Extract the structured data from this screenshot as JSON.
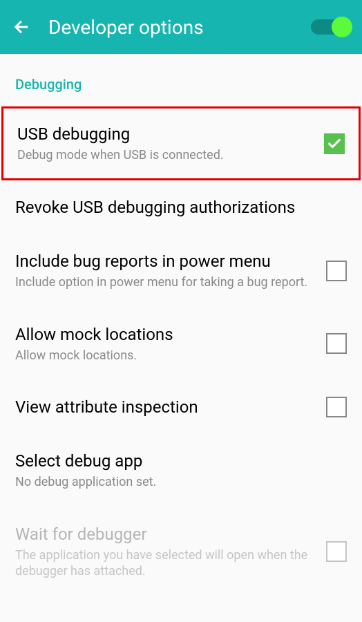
{
  "header": {
    "title": "Developer options",
    "master_toggle": true
  },
  "section": {
    "label": "Debugging"
  },
  "items": [
    {
      "title": "USB debugging",
      "subtitle": "Debug mode when USB is connected.",
      "checked": true,
      "highlighted": true
    },
    {
      "title": "Revoke USB debugging authorizations",
      "subtitle": null,
      "checkbox": false
    },
    {
      "title": "Include bug reports in power menu",
      "subtitle": "Include option in power menu for taking a bug report.",
      "checked": false
    },
    {
      "title": "Allow mock locations",
      "subtitle": "Allow mock locations.",
      "checked": false
    },
    {
      "title": "View attribute inspection",
      "subtitle": null,
      "checked": false
    },
    {
      "title": "Select debug app",
      "subtitle": "No debug application set.",
      "checkbox": false
    },
    {
      "title": "Wait for debugger",
      "subtitle": "The application you have selected will open when the debugger has attached.",
      "checked": false,
      "disabled": true
    }
  ]
}
